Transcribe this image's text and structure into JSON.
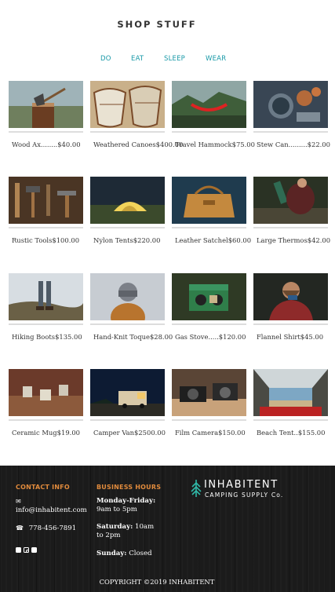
{
  "header": {
    "title": "SHOP STUFF"
  },
  "nav": [
    {
      "label": "DO"
    },
    {
      "label": "EAT"
    },
    {
      "label": "SLEEP"
    },
    {
      "label": "WEAR"
    }
  ],
  "products": [
    {
      "name": "Wood Ax........",
      "price": "$40.00",
      "image": "axe"
    },
    {
      "name": "Weathered Canoes",
      "price": "$400.00",
      "image": "canoes"
    },
    {
      "name": "Travel Hammock",
      "price": "$75.00",
      "image": "hammock"
    },
    {
      "name": "Stew Can.........",
      "price": "$22.00",
      "image": "stew"
    },
    {
      "name": "Rustic Tools",
      "price": "$100.00",
      "image": "tools"
    },
    {
      "name": "Nylon Tents",
      "price": "$220.00",
      "image": "tent"
    },
    {
      "name": "Leather Satchel",
      "price": "$60.00",
      "image": "satchel"
    },
    {
      "name": "Large Thermos",
      "price": "$42.00",
      "image": "thermos"
    },
    {
      "name": "Hiking Boots",
      "price": "$135.00",
      "image": "boots"
    },
    {
      "name": "Hand-Knit Toque",
      "price": "$28.00",
      "image": "toque"
    },
    {
      "name": "Gas Stove.....",
      "price": "$120.00",
      "image": "stove"
    },
    {
      "name": "Flannel Shirt",
      "price": "$45.00",
      "image": "flannel"
    },
    {
      "name": "Ceramic Mug",
      "price": "$19.00",
      "image": "mug"
    },
    {
      "name": "Camper Van",
      "price": "$2500.00",
      "image": "van"
    },
    {
      "name": "Film Camera",
      "price": "$150.00",
      "image": "camera"
    },
    {
      "name": "Beach Tent..",
      "price": "$155.00",
      "image": "beachtent"
    }
  ],
  "footer": {
    "contact_heading": "CONTACT INFO",
    "email": "info@inhabitent.com",
    "phone": "778-456-7891",
    "hours_heading": "BUSINESS HOURS",
    "hours": [
      {
        "day": "Monday-Friday:",
        "time": "9am to 5pm"
      },
      {
        "day": "Saturday:",
        "time": "10am to 2pm"
      },
      {
        "day": "Sunday:",
        "time": "Closed"
      }
    ],
    "brand_name": "INHABITENT",
    "brand_sub": "CAMPING SUPPLY Co.",
    "copyright": "COPYRIGHT ©2019 INHABITENT",
    "social": [
      "facebook-icon",
      "instagram-icon",
      "twitter-icon"
    ]
  },
  "colors": {
    "nav_link": "#1a9aa8",
    "footer_heading": "#e08a3c",
    "footer_bg": "#1b1b1b",
    "brand_tree": "#2fb8a7"
  }
}
